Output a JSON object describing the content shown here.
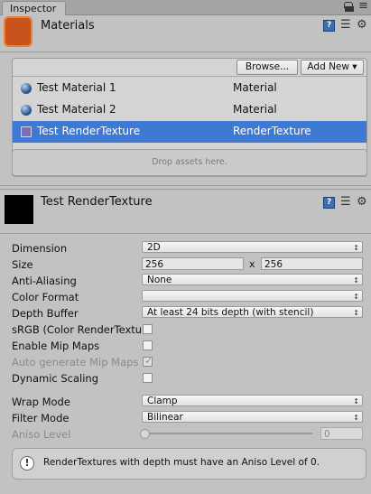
{
  "tab": {
    "title": "Inspector"
  },
  "header": {
    "title": "Materials"
  },
  "toolbar": {
    "browse_label": "Browse...",
    "add_new_label": "Add New ▾"
  },
  "list": {
    "rows": [
      {
        "name": "Test Material 1",
        "type": "Material",
        "icon": "material-sphere-icon"
      },
      {
        "name": "Test Material 2",
        "type": "Material",
        "icon": "material-sphere-icon"
      },
      {
        "name": "Test RenderTexture",
        "type": "RenderTexture",
        "icon": "render-texture-icon",
        "selected": true
      }
    ],
    "drop_text": "Drop assets here."
  },
  "render_texture": {
    "title": "Test RenderTexture",
    "dimension": {
      "label": "Dimension",
      "value": "2D"
    },
    "size": {
      "label": "Size",
      "width": "256",
      "x": "x",
      "height": "256"
    },
    "anti_aliasing": {
      "label": "Anti-Aliasing",
      "value": "None"
    },
    "color_format": {
      "label": "Color Format",
      "value": ""
    },
    "depth_buffer": {
      "label": "Depth Buffer",
      "value": "At least 24 bits depth (with stencil)"
    },
    "srgb": {
      "label": "sRGB (Color RenderTextu",
      "checked": false
    },
    "enable_mip_maps": {
      "label": "Enable Mip Maps",
      "checked": false
    },
    "auto_generate_mip_maps": {
      "label": "Auto generate Mip Maps",
      "checked": true,
      "disabled": true
    },
    "dynamic_scaling": {
      "label": "Dynamic Scaling",
      "checked": false
    },
    "wrap_mode": {
      "label": "Wrap Mode",
      "value": "Clamp"
    },
    "filter_mode": {
      "label": "Filter Mode",
      "value": "Bilinear"
    },
    "aniso_level": {
      "label": "Aniso Level",
      "value": "0",
      "slider_fraction": 0.0,
      "disabled": true
    },
    "message": "RenderTextures with depth must have an Aniso Level of 0."
  },
  "colors": {
    "selection": "#3e7ad3",
    "panel": "#c2c2c2",
    "header_icon": "#c8541c"
  }
}
